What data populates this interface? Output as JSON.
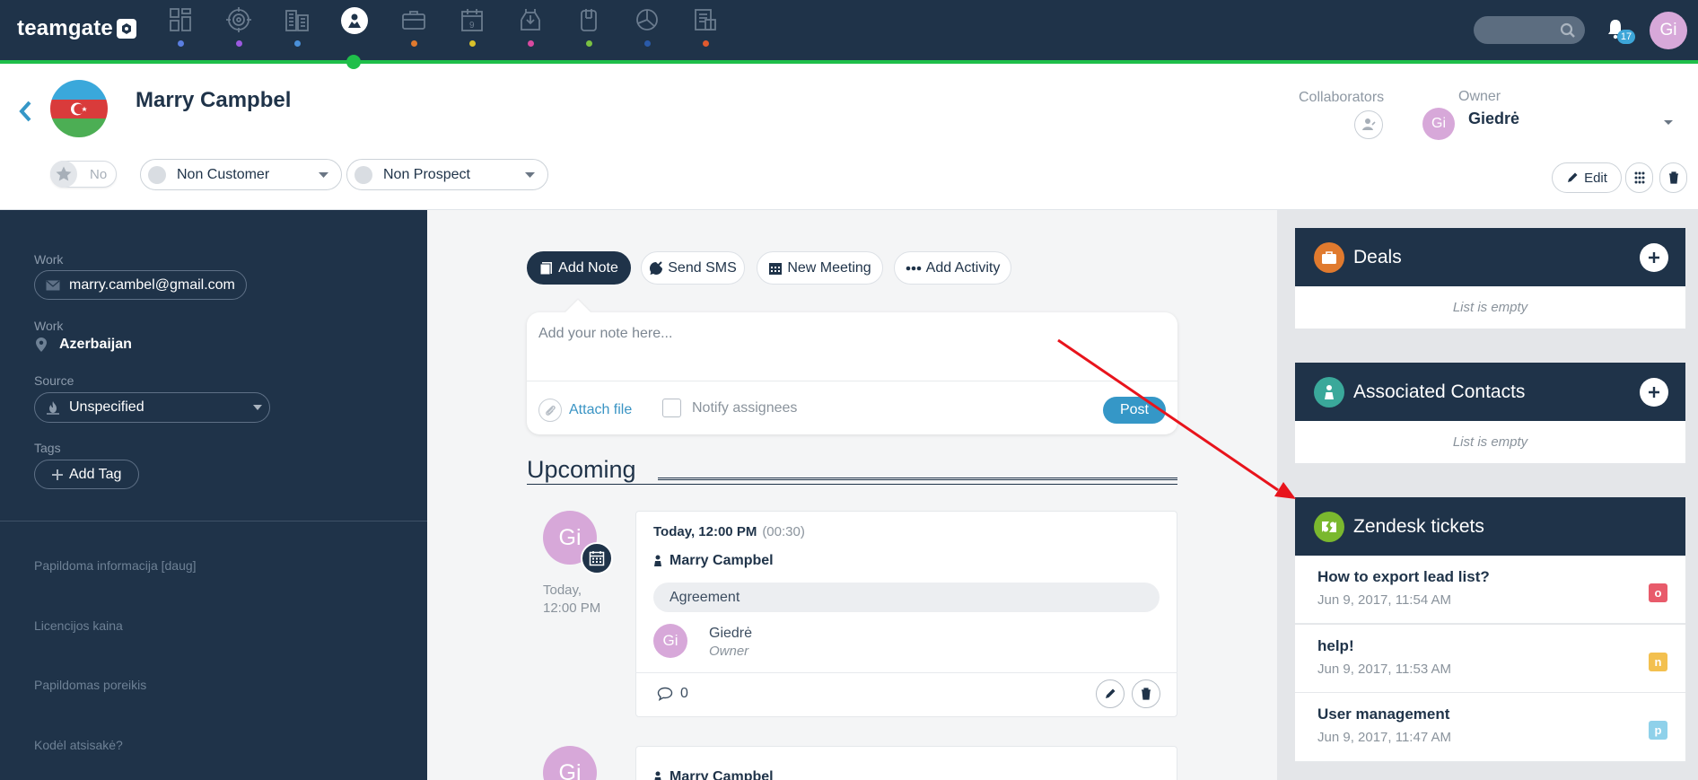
{
  "app": {
    "logo_text": "teamgate"
  },
  "nav": {
    "items": [
      {
        "name": "nav-dashboard",
        "icon": "dashboard-icon",
        "dot_color": "#5a7ee0"
      },
      {
        "name": "nav-leads",
        "icon": "target-icon",
        "dot_color": "#9b59e0"
      },
      {
        "name": "nav-companies",
        "icon": "building-icon",
        "dot_color": "#4a90d9"
      },
      {
        "name": "nav-people",
        "icon": "person-icon",
        "dot_color": "#1fbf4a",
        "active": true
      },
      {
        "name": "nav-deals",
        "icon": "briefcase-icon",
        "dot_color": "#e07a2e"
      },
      {
        "name": "nav-calendar",
        "icon": "calendar-icon",
        "dot_color": "#d9c12a"
      },
      {
        "name": "nav-inbox",
        "icon": "inbox-icon",
        "dot_color": "#d94aa0"
      },
      {
        "name": "nav-documents",
        "icon": "document-icon",
        "dot_color": "#7ac142"
      },
      {
        "name": "nav-reports",
        "icon": "pie-chart-icon",
        "dot_color": "#2a5aa8"
      },
      {
        "name": "nav-invoices",
        "icon": "invoice-icon",
        "dot_color": "#e05a2e"
      }
    ],
    "notification_count": "17",
    "user_initials": "Gi"
  },
  "contact": {
    "name": "Marry Campbel",
    "collaborators_label": "Collaborators",
    "owner_label": "Owner",
    "owner_initials": "Gi",
    "owner_name": "Giedrė",
    "favorite_label": "No",
    "customer_status": "Non Customer",
    "prospect_status": "Non Prospect",
    "edit_label": "Edit"
  },
  "details": {
    "email_label": "Work",
    "email": "marry.cambel@gmail.com",
    "address_label": "Work",
    "address": "Azerbaijan",
    "source_label": "Source",
    "source_value": "Unspecified",
    "tags_label": "Tags",
    "add_tag_label": "Add Tag",
    "extra_fields": [
      "Papildoma informacija [daug]",
      "Licencijos kaina",
      "Papildomas poreikis",
      "Kodėl atsisakė?"
    ]
  },
  "composer": {
    "tabs": [
      "Add Note",
      "Send SMS",
      "New Meeting",
      "Add Activity"
    ],
    "placeholder": "Add your note here...",
    "attach_label": "Attach file",
    "notify_label": "Notify assignees",
    "post_label": "Post"
  },
  "timeline": {
    "heading": "Upcoming",
    "activity": {
      "avatar_initials": "Gi",
      "side_time_line1": "Today,",
      "side_time_line2": "12:00 PM",
      "datetime": "Today, 12:00 PM",
      "duration": "(00:30)",
      "contact": "Marry Campbel",
      "type": "Agreement",
      "owner_initials": "Gi",
      "owner_name": "Giedrė",
      "owner_role": "Owner",
      "comments_count": "0"
    },
    "activity2": {
      "avatar_initials": "Gi",
      "contact": "Marry Campbel"
    }
  },
  "widgets": {
    "deals": {
      "title": "Deals",
      "empty_label": "List is empty"
    },
    "contacts": {
      "title": "Associated Contacts",
      "empty_label": "List is empty"
    },
    "zendesk": {
      "title": "Zendesk tickets",
      "tickets": [
        {
          "title": "How to export lead list?",
          "date": "Jun 9, 2017, 11:54 AM",
          "badge": "o",
          "badge_color": "#e85b6b"
        },
        {
          "title": "help!",
          "date": "Jun 9, 2017, 11:53 AM",
          "badge": "n",
          "badge_color": "#f3c04f"
        },
        {
          "title": "User management",
          "date": "Jun 9, 2017, 11:47 AM",
          "badge": "p",
          "badge_color": "#8fd1ea"
        }
      ]
    }
  },
  "colors": {
    "navy": "#1f3349",
    "accent_green": "#1fbf4a",
    "link_blue": "#3a94c4",
    "arrow_red": "#e8141c"
  }
}
